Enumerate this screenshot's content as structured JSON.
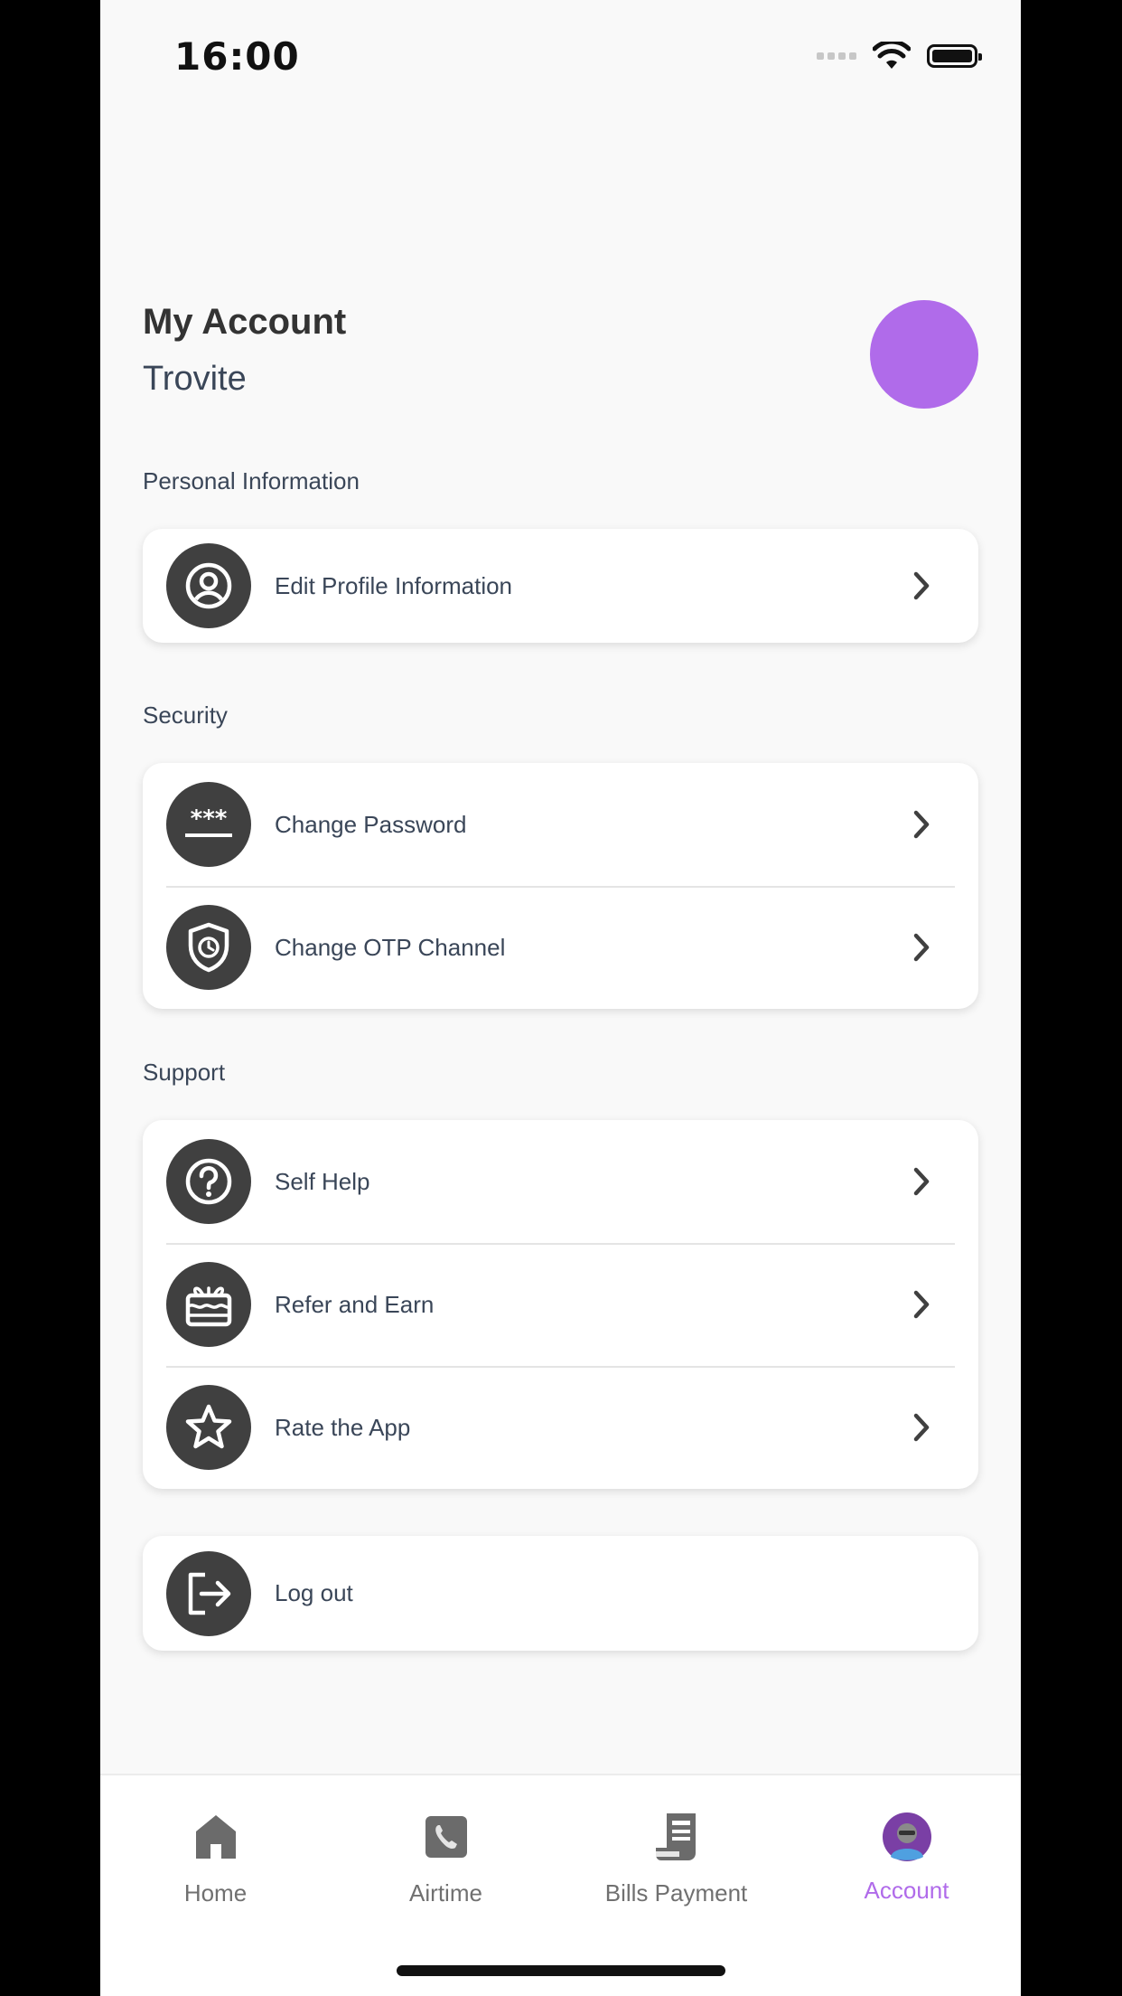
{
  "status_bar": {
    "time": "16:00"
  },
  "header": {
    "title": "My Account",
    "username": "Trovite",
    "avatar_color": "#b06bea"
  },
  "sections": {
    "personal": {
      "label": "Personal Information",
      "items": [
        {
          "label": "Edit Profile Information",
          "icon": "user-circle-icon"
        }
      ]
    },
    "security": {
      "label": "Security",
      "items": [
        {
          "label": "Change Password",
          "icon": "password-icon"
        },
        {
          "label": "Change OTP Channel",
          "icon": "shield-clock-icon"
        }
      ]
    },
    "support": {
      "label": "Support",
      "items": [
        {
          "label": "Self Help",
          "icon": "question-icon"
        },
        {
          "label": "Refer and Earn",
          "icon": "gift-icon"
        },
        {
          "label": "Rate the App",
          "icon": "star-icon"
        }
      ]
    }
  },
  "logout": {
    "label": "Log out",
    "icon": "logout-icon"
  },
  "tabbar": {
    "tabs": [
      {
        "label": "Home",
        "icon": "home-icon"
      },
      {
        "label": "Airtime",
        "icon": "phone-icon"
      },
      {
        "label": "Bills Payment",
        "icon": "receipt-icon"
      },
      {
        "label": "Account",
        "icon": "avatar-icon",
        "active": true
      }
    ],
    "active_color": "#b06bea"
  }
}
